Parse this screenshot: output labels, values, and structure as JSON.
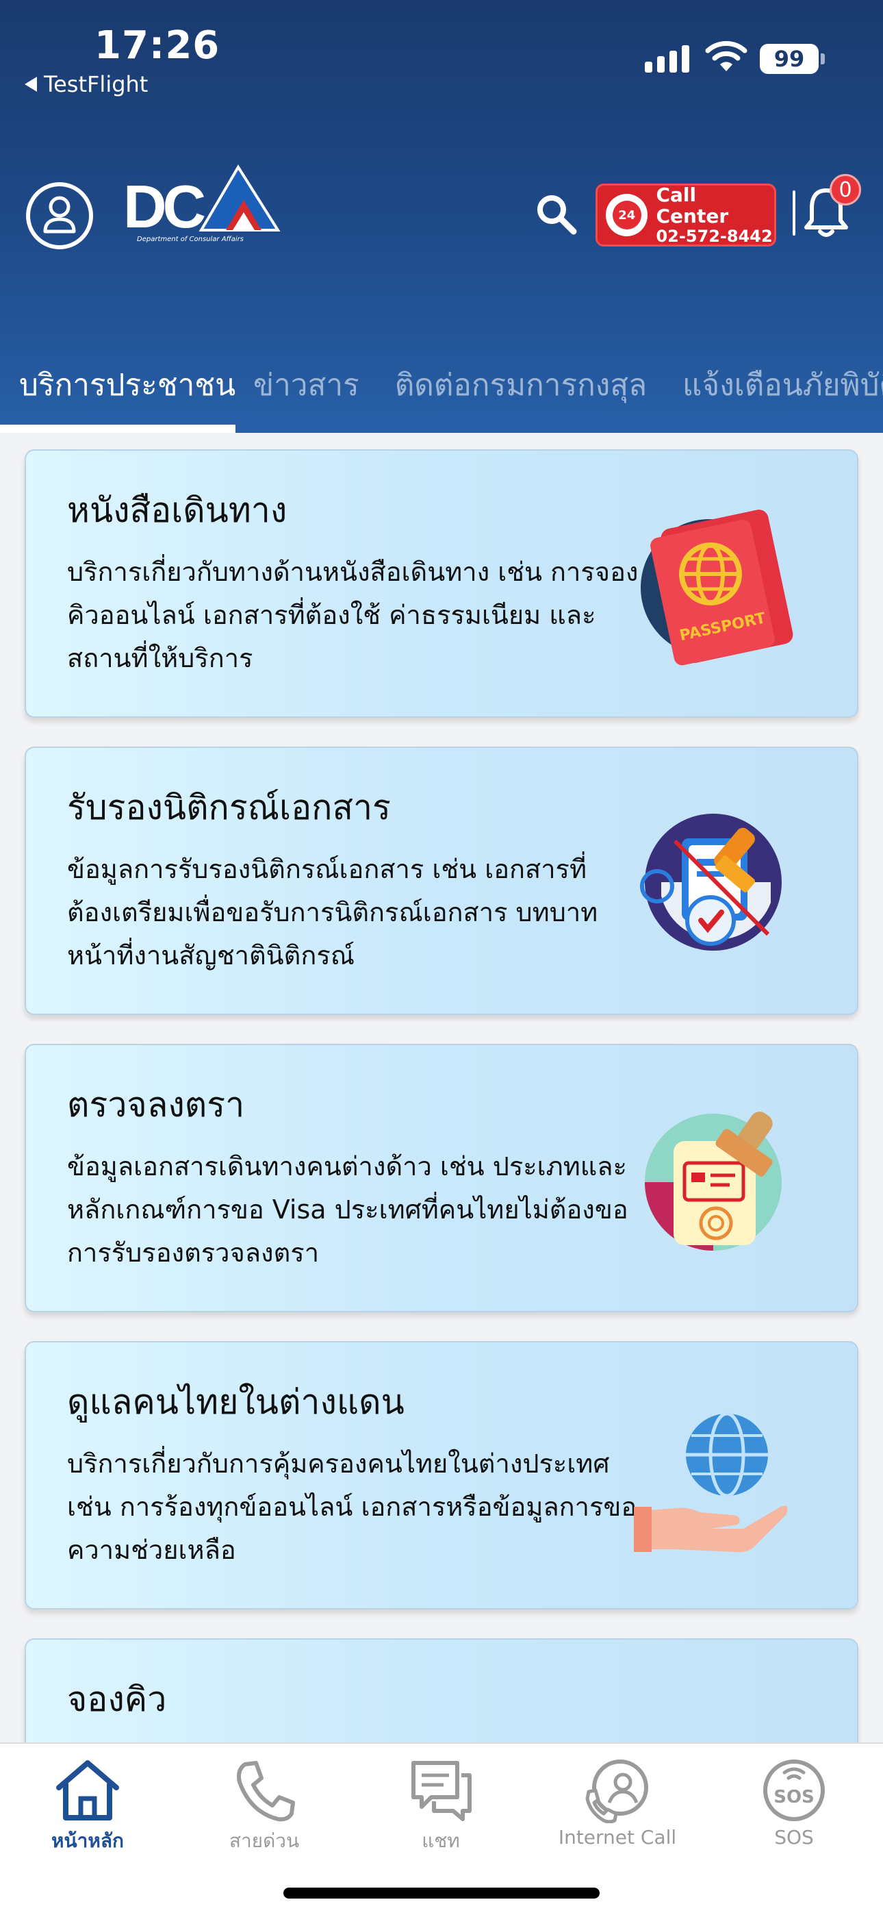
{
  "status": {
    "time": "17:26",
    "back_app": "TestFlight",
    "battery": "99"
  },
  "header": {
    "logo_text": "DCA",
    "logo_subtitle": "Department of Consular Affairs",
    "call_center": {
      "title": "Call Center",
      "number": "02-572-8442",
      "badge": "24"
    },
    "notification_count": "0"
  },
  "tabs": [
    {
      "label": "บริการประชาชน",
      "active": true
    },
    {
      "label": "ข่าวสาร",
      "active": false
    },
    {
      "label": "ติดต่อกรมการกงสุล",
      "active": false
    },
    {
      "label": "แจ้งเตือนภัยพิบัติ",
      "active": false
    }
  ],
  "cards": [
    {
      "title": "หนังสือเดินทาง",
      "description": "บริการเกี่ยวกับทางด้านหนังสือเดินทาง เช่น การจองคิวออนไลน์ เอกสารที่ต้องใช้ ค่าธรรมเนียม และสถานที่ให้บริการ",
      "icon": "passport-icon",
      "icon_text": "PASSPORT"
    },
    {
      "title": "รับรองนิติกรณ์เอกสาร",
      "description": "ข้อมูลการรับรองนิติกรณ์เอกสาร เช่น  เอกสารที่ต้องเตรียมเพื่อขอรับการนิติกรณ์เอกสาร บทบาทหน้าที่งานสัญชาตินิติกรณ์",
      "icon": "document-stamp-icon"
    },
    {
      "title": "ตรวจลงตรา",
      "description": "ข้อมูลเอกสารเดินทางคนต่างด้าว เช่น ประเภทและหลักเกณฑ์การขอ Visa ประเทศที่คนไทยไม่ต้องขอการรับรองตรวจลงตรา",
      "icon": "visa-stamp-icon"
    },
    {
      "title": "ดูแลคนไทยในต่างแดน",
      "description": "บริการเกี่ยวกับการคุ้มครองคนไทยในต่างประเทศ เช่น การร้องทุกข์ออนไลน์ เอกสารหรือข้อมูลการขอความช่วยเหลือ",
      "icon": "globe-hand-icon"
    },
    {
      "title": "จองคิว",
      "description": "",
      "icon": "calendar-icon"
    }
  ],
  "bottom_nav": [
    {
      "label": "หน้าหลัก",
      "icon": "home-icon",
      "active": true
    },
    {
      "label": "สายด่วน",
      "icon": "phone-icon",
      "active": false
    },
    {
      "label": "แชท",
      "icon": "chat-icon",
      "active": false
    },
    {
      "label": "Internet Call",
      "icon": "internet-call-icon",
      "active": false
    },
    {
      "label": "SOS",
      "icon": "sos-icon",
      "active": false
    }
  ],
  "colors": {
    "header_top": "#1a3a6e",
    "header_bottom": "#2860a8",
    "call_center_red": "#d8232a",
    "nav_active": "#1f4f94",
    "card_bg": "#c8e8fb"
  }
}
